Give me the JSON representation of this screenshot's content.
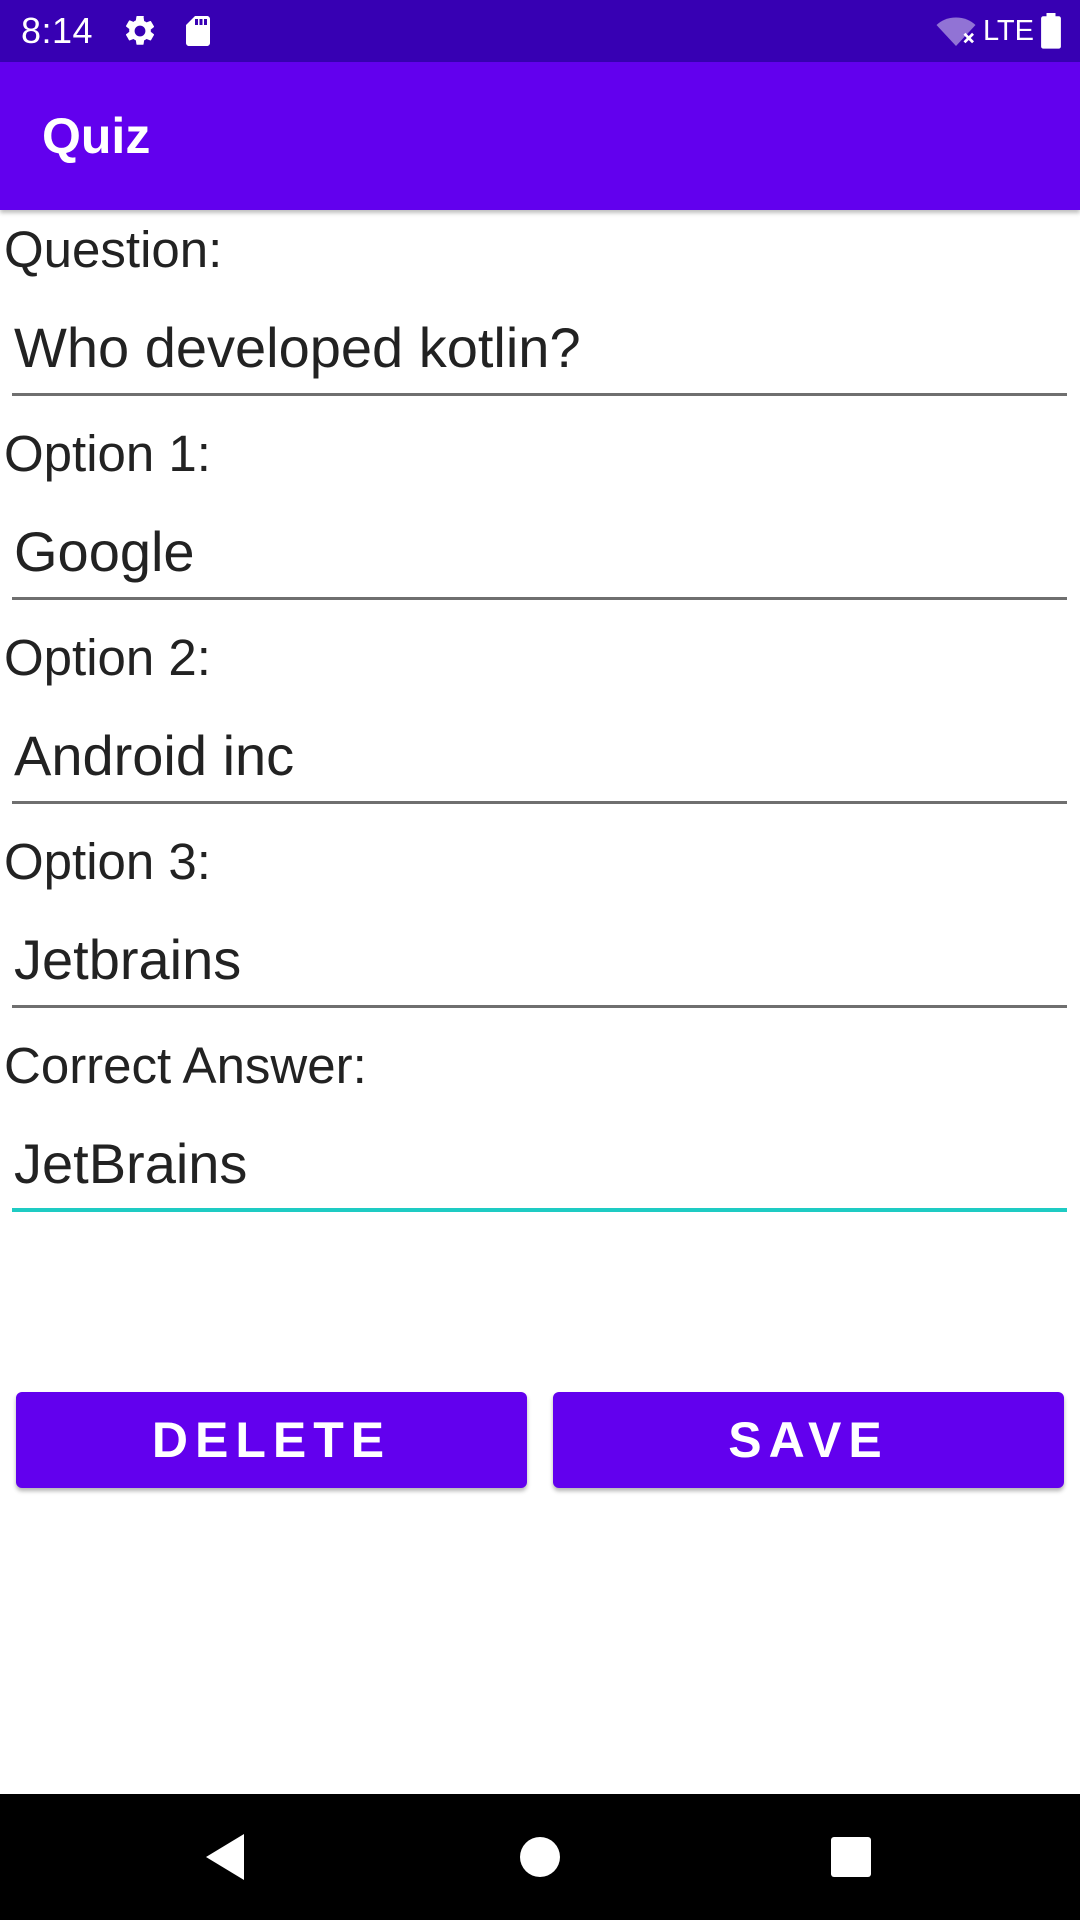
{
  "status_bar": {
    "time": "8:14",
    "network_label": "LTE",
    "background_color": "#3700B3",
    "icons": [
      "settings-icon",
      "sd-card-icon",
      "wifi-off-icon",
      "battery-icon"
    ]
  },
  "app_bar": {
    "title": "Quiz",
    "background_color": "#6200EE"
  },
  "form": {
    "question": {
      "label": "Question:",
      "value": "Who developed kotlin?"
    },
    "option1": {
      "label": "Option 1:",
      "value": "Google"
    },
    "option2": {
      "label": "Option 2:",
      "value": "Android inc"
    },
    "option3": {
      "label": "Option 3:",
      "value": "Jetbrains"
    },
    "answer": {
      "label": "Correct Answer:",
      "value": "JetBrains",
      "focused": true
    },
    "focus_color": "#1ECBC3"
  },
  "buttons": {
    "delete_label": "DELETE",
    "save_label": "SAVE"
  },
  "nav_bar": {
    "icons": [
      "back-icon",
      "home-icon",
      "recents-icon"
    ]
  }
}
